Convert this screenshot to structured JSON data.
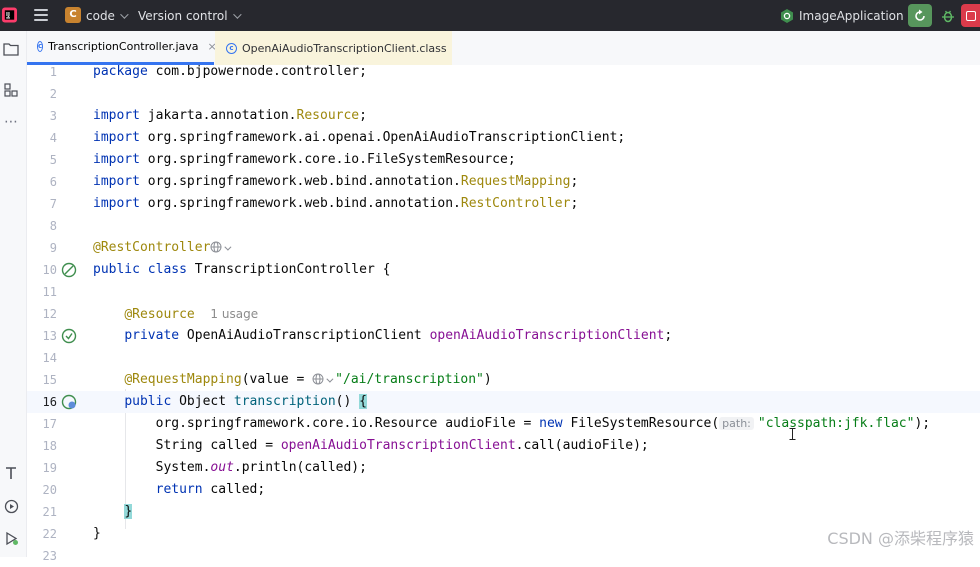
{
  "titlebar": {
    "project_initial": "C",
    "project_name": "code",
    "vcs_label": "Version control",
    "run_config": "ImageApplication"
  },
  "tabs": [
    {
      "label": "TranscriptionController.java",
      "active": true,
      "close": "×"
    },
    {
      "label": "OpenAiAudioTranscriptionClient.class",
      "active": false
    }
  ],
  "editor": {
    "current_line": 16,
    "lines": [
      {
        "n": "1"
      },
      {
        "n": "2"
      },
      {
        "n": "3"
      },
      {
        "n": "4"
      },
      {
        "n": "5"
      },
      {
        "n": "6"
      },
      {
        "n": "7"
      },
      {
        "n": "8"
      },
      {
        "n": "9"
      },
      {
        "n": "10"
      },
      {
        "n": "11"
      },
      {
        "n": "12"
      },
      {
        "n": "13"
      },
      {
        "n": "14"
      },
      {
        "n": "15"
      },
      {
        "n": "16"
      },
      {
        "n": "17"
      },
      {
        "n": "18"
      },
      {
        "n": "19"
      },
      {
        "n": "20"
      },
      {
        "n": "21"
      },
      {
        "n": "22"
      },
      {
        "n": "23"
      }
    ],
    "tokens": {
      "l1_kw": "package",
      "l1_rest": " com.bjpowernode.controller;",
      "import_kw": "import",
      "l3_pre": " jakarta.annotation.",
      "l3_ann": "Resource",
      "l3_end": ";",
      "l4_rest": " org.springframework.ai.openai.OpenAiAudioTranscriptionClient;",
      "l5_rest": " org.springframework.core.io.FileSystemResource;",
      "l6_pre": " org.springframework.web.bind.annotation.",
      "l6_ann": "RequestMapping",
      "l6_end": ";",
      "l7_pre": " org.springframework.web.bind.annotation.",
      "l7_ann": "RestController",
      "l7_end": ";",
      "l9_ann": "@RestController",
      "l10_kw1": "public",
      "l10_kw2": "class",
      "l10_rest": " TranscriptionController {",
      "l12_ann": "@Resource",
      "l12_hint": "1 usage",
      "l13_kw": "private",
      "l13_type": " OpenAiAudioTranscriptionClient ",
      "l13_fld": "openAiAudioTranscriptionClient",
      "l13_end": ";",
      "l15_ann": "@RequestMapping",
      "l15_mid": "(value = ",
      "l15_str": "\"/ai/transcription\"",
      "l15_end": ")",
      "l16_kw": "public",
      "l16_type": " Object ",
      "l16_mth": "transcription",
      "l16_paren": "() ",
      "l16_brace": "{",
      "l17_pre": "org.springframework.core.io.Resource audioFile = ",
      "l17_kw": "new",
      "l17_mid": " FileSystemResource(",
      "l17_hint": "path:",
      "l17_str": "\"classpath:jfk.flac\"",
      "l17_end": ");",
      "l18_pre": "String called = ",
      "l18_fld": "openAiAudioTranscriptionClient",
      "l18_end": ".call(audioFile);",
      "l19_pre": "System.",
      "l19_fld": "out",
      "l19_end": ".println(called);",
      "l20_kw": "return",
      "l20_end": " called;",
      "l21_brace": "}",
      "l22_brace": "}"
    }
  },
  "watermark": "CSDN @添柴程序猿",
  "colors": {
    "titlebar": "#27282e",
    "accent": "#3574f0",
    "keyword": "#0033b3",
    "annotation": "#9e880d",
    "field": "#871094",
    "string": "#067d17"
  }
}
